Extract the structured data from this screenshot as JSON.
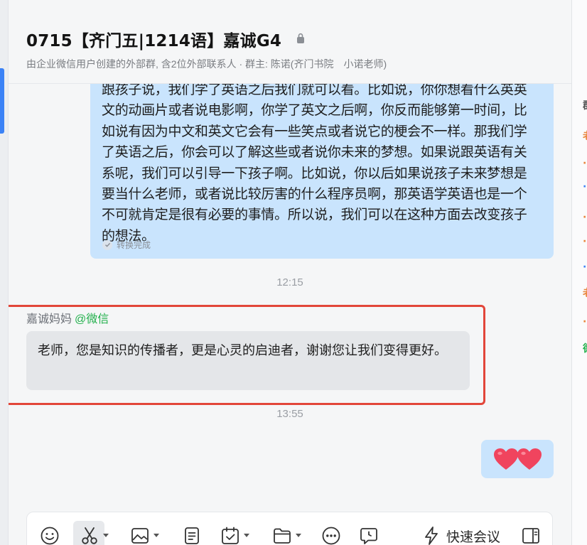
{
  "header": {
    "title": "0715【齐门五|1214语】嘉诚G4",
    "subtitle": "由企业微信用户创建的外部群, 含2位外部联系人 · 群主: 陈诺(齐门书院　小诺老师)"
  },
  "right_panel": {
    "fragments": [
      "群",
      "老",
      "·",
      "·",
      "·",
      "·",
      "·",
      "老",
      "·",
      "德"
    ]
  },
  "messages": {
    "outgoing_text": "跟孩子说，我们学了英语之后我们就可以看。比如说，你你想看什么英英文的动画片或者说电影啊，你学了英文之后啊，你反而能够第一时间，比如说有因为中文和英文它会有一些笑点或者说它的梗会不一样。那我们学了英语之后，你会可以了解这些或者说你未来的梦想。如果说跟英语有关系呢，我们可以引导一下孩子啊。比如说，你以后如果说孩子未来梦想是要当什么老师，或者说比较厉害的什么程序员啊，那英语学英语也是一个不可就肯定是很有必要的事情。所以说，我们可以在这种方面去改变孩子的想法。",
    "convert_status": "转换完成",
    "time_1": "12:15",
    "sender_name": "嘉诚妈妈",
    "sender_source": "@微信",
    "incoming_text": "老师，您是知识的传播者，更是心灵的启迪者，谢谢您让我们变得更好。",
    "time_2": "13:55",
    "reply_emoji": "two-hearts"
  },
  "composer": {
    "tools": [
      "emoji-icon",
      "scissors-icon",
      "image-icon",
      "document-icon",
      "calendar-check-icon",
      "folder-icon",
      "more-icon",
      "chat-icon",
      "lightning-icon",
      "sidebar-icon"
    ],
    "quick_meeting_label": "快速会议"
  },
  "colors": {
    "outgoing_bubble": "#c9e4fd",
    "incoming_bubble": "#e4e6e9",
    "highlight_border": "#e2463a",
    "wechat_source": "#21b04b",
    "accent": "#3b82f6",
    "heart": "#f0445e"
  }
}
